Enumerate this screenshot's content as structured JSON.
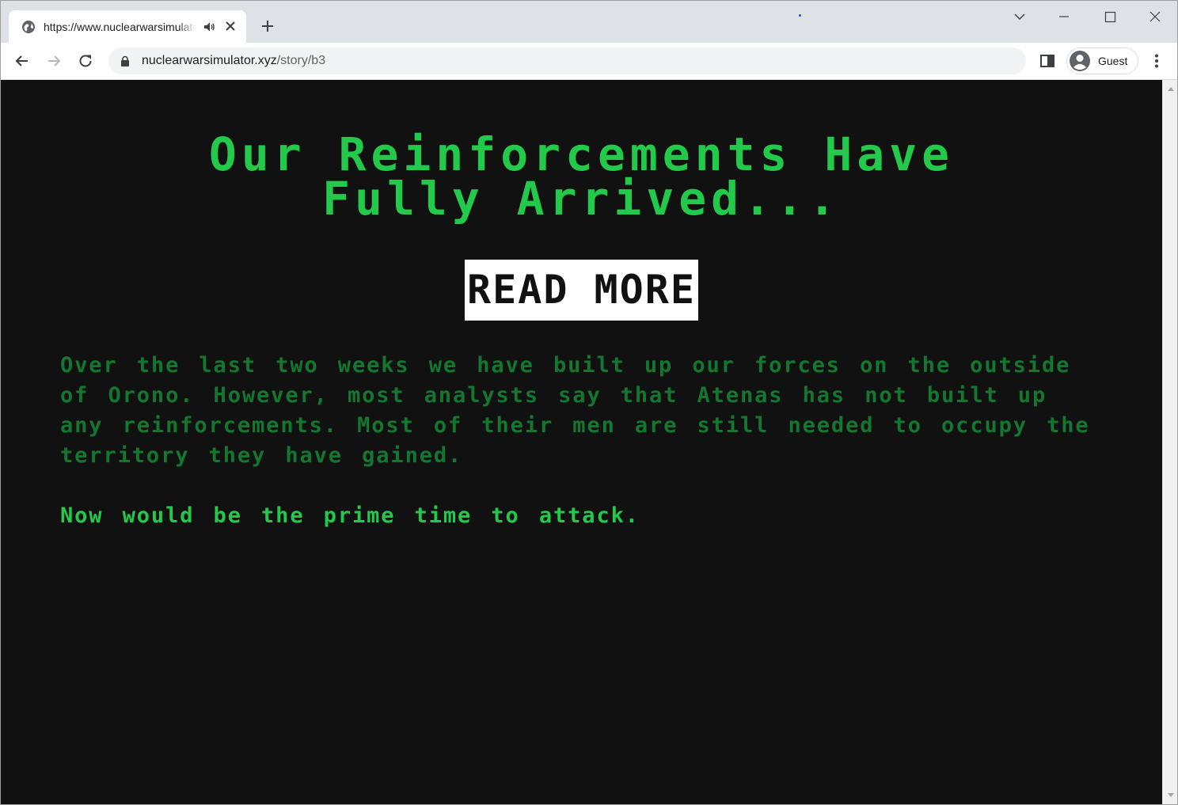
{
  "browser": {
    "tab": {
      "title": "https://www.nuclearwarsimulator.xyz/story/b3",
      "favicon": "globe-icon",
      "audio": "speaker-icon"
    },
    "omnibox": {
      "host": "nuclearwarsimulator.xyz",
      "path": "/story/b3"
    },
    "profile": {
      "label": "Guest"
    }
  },
  "page": {
    "headline_line1": "Our Reinforcements Have",
    "headline_line2": "Fully Arrived...",
    "read_more_label": "READ MORE",
    "story_text": "Over the last two weeks we have built up our forces on the outside of Orono. However, most analysts say that Atenas has not built up any reinforcements. Most of their men are still needed to occupy the territory they have gained.",
    "callout_text": "Now would be the prime time to attack.",
    "colors": {
      "background": "#111111",
      "headline": "#22c94a",
      "story": "#14772f",
      "button_bg": "#ffffff"
    }
  }
}
